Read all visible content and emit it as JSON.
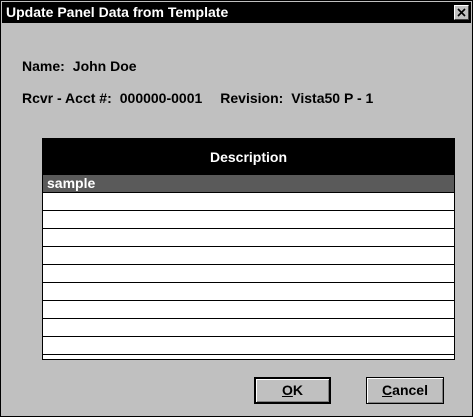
{
  "window": {
    "title": "Update Panel Data from Template",
    "close_icon": "close-icon"
  },
  "info": {
    "name_label": "Name:",
    "name_value": "John Doe",
    "account_label": "Rcvr - Acct #:",
    "account_value": "000000-0001",
    "revision_label": "Revision:",
    "revision_value": "Vista50 P - 1"
  },
  "grid": {
    "header": "Description",
    "rows": [
      "sample",
      "",
      "",
      "",
      "",
      "",
      "",
      "",
      "",
      ""
    ],
    "selected_index": 0
  },
  "buttons": {
    "ok_accel": "O",
    "ok_rest": "K",
    "cancel_accel": "C",
    "cancel_rest": "ancel"
  },
  "colors": {
    "titlebar": "#000000",
    "dialog_bg": "#c0c0c0",
    "selected_row": "#5a5a5a"
  }
}
